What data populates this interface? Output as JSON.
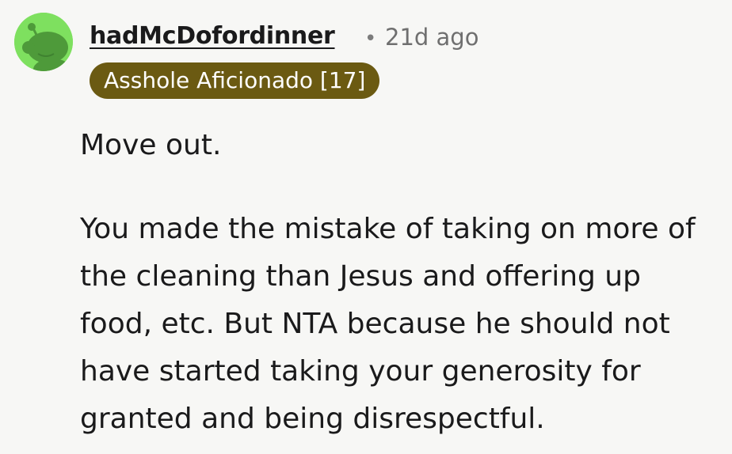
{
  "comment": {
    "author": "hadMcDofordinner",
    "separator": "•",
    "timestamp": "21d ago",
    "flair": "Asshole Aficionado [17]",
    "paragraphs": [
      "Move out.",
      "You made the mistake of taking on more of the cleaning than Jesus and offering up food, etc. But NTA because he should not have started taking your generosity for granted and being disrespectful."
    ]
  },
  "avatar": {
    "icon": "snoo-avatar-icon",
    "background_color": "#7ee05f",
    "figure_color": "#4e9a3a"
  },
  "colors": {
    "flair_background": "#6b5a12",
    "flair_text": "#ffffff",
    "page_background": "#f7f7f5",
    "timestamp_text": "#6f6f6f"
  }
}
